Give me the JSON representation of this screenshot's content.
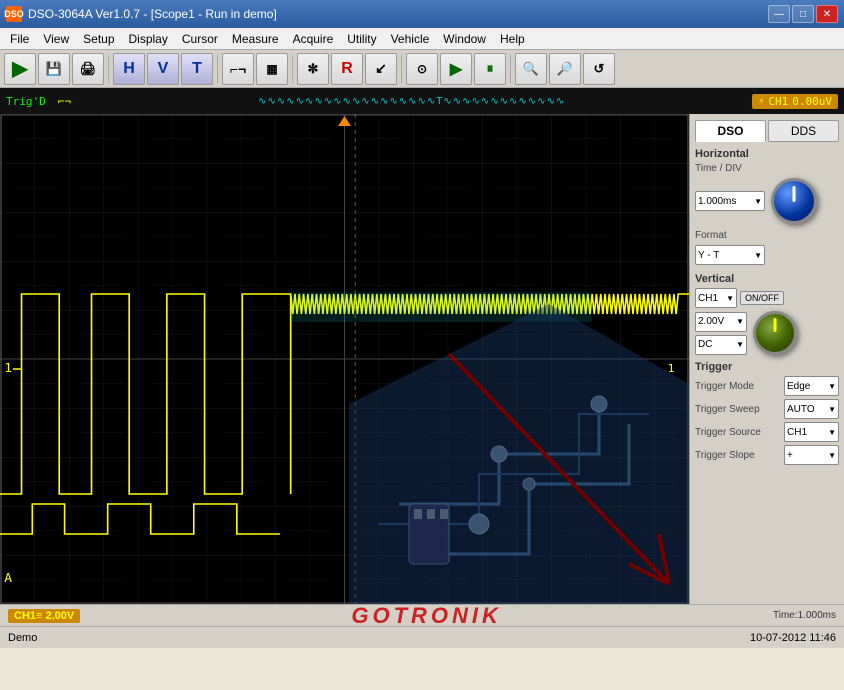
{
  "titleBar": {
    "icon": "DSO",
    "title": "DSO-3064A Ver1.0.7 - [Scope1 - Run in demo]",
    "btnMinimize": "—",
    "btnMaximize": "□",
    "btnClose": "✕"
  },
  "menuBar": {
    "items": [
      "File",
      "View",
      "Setup",
      "Display",
      "Cursor",
      "Measure",
      "Acquire",
      "Utility",
      "Vehicle",
      "Window",
      "Help"
    ]
  },
  "toolbar": {
    "buttons": [
      {
        "label": "▶",
        "name": "open-btn"
      },
      {
        "label": "💾",
        "name": "save-btn"
      },
      {
        "label": "🖨",
        "name": "print-btn"
      },
      {
        "label": "H",
        "name": "h-btn"
      },
      {
        "label": "V",
        "name": "v-btn"
      },
      {
        "label": "T",
        "name": "t-btn"
      },
      {
        "label": "⌐¬",
        "name": "pulse-btn"
      },
      {
        "label": "▦",
        "name": "fft-btn"
      },
      {
        "label": "✼",
        "name": "math-btn"
      },
      {
        "label": "R",
        "name": "ref-btn"
      },
      {
        "label": "⌂",
        "name": "cursor-btn"
      },
      {
        "label": "⊙",
        "name": "meas-btn"
      },
      {
        "label": "▶▶",
        "name": "run-btn"
      },
      {
        "label": "⏸",
        "name": "pause-btn"
      },
      {
        "label": "🔍+",
        "name": "zoom-in-btn"
      },
      {
        "label": "🔍-",
        "name": "zoom-out-btn"
      },
      {
        "label": "↺",
        "name": "reset-btn"
      }
    ]
  },
  "statusStrip": {
    "trigLabel": "Trig'D",
    "ch1Badge": "CH1",
    "voltage": "0.00uV"
  },
  "rightPanel": {
    "tab1": "DSO",
    "tab2": "DDS",
    "horizontal": {
      "title": "Horizontal",
      "timeDiv": {
        "label": "Time / DIV",
        "value": "1.000ms"
      },
      "format": {
        "label": "Format",
        "value": "Y - T"
      }
    },
    "vertical": {
      "title": "Vertical",
      "channel": "CH1",
      "onoff": "ON/OFF",
      "voltage": "2.00V",
      "coupling": "DC"
    },
    "trigger": {
      "title": "Trigger",
      "mode": {
        "label": "Trigger Mode",
        "value": "Edge"
      },
      "sweep": {
        "label": "Trigger Sweep",
        "value": "AUTO"
      },
      "source": {
        "label": "Trigger Source",
        "value": "CH1"
      },
      "slope": {
        "label": "Trigger Slope",
        "value": "+"
      }
    }
  },
  "bottomBar": {
    "ch1Info": "CH1≡  2.00V",
    "gotronik": "GOTRONIK",
    "timeInfo": "Time:1.000ms",
    "demoLabel": "Demo",
    "dateTime": "10-07-2012  11:46"
  }
}
